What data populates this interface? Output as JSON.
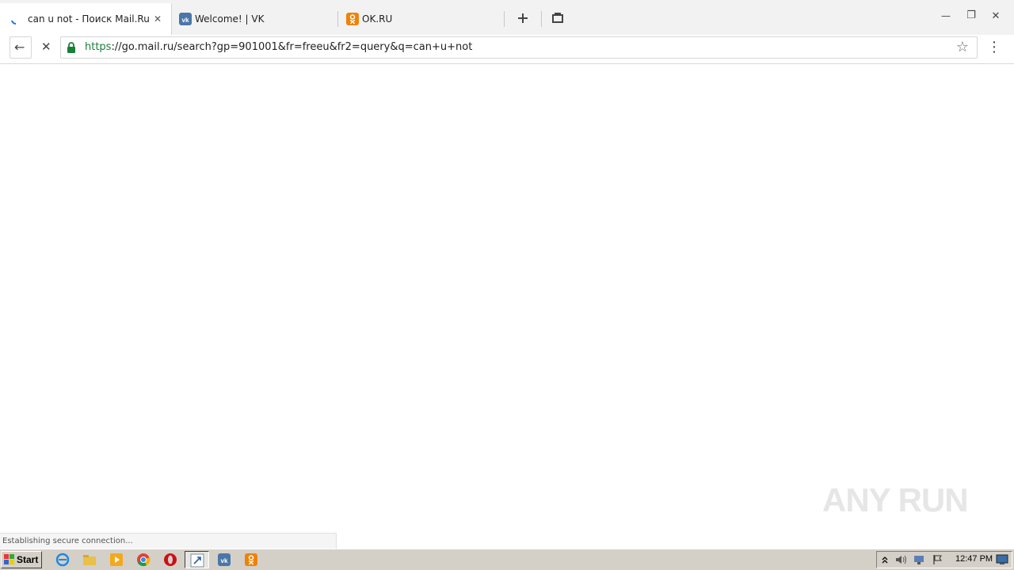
{
  "tabs": [
    {
      "title": "can u not - Поиск Mail.Ru",
      "close": "✕",
      "favicon": "loading-spinner-icon"
    },
    {
      "title": "Welcome! | VK",
      "favicon": "vk-icon"
    },
    {
      "title": "OK.RU",
      "favicon": "ok-icon"
    }
  ],
  "window": {
    "minimize": "—",
    "restore": "❐",
    "close": "✕"
  },
  "toolbar": {
    "back": "←",
    "stop": "✕",
    "url_scheme": "https",
    "url_rest": "://go.mail.ru/search?gp=901001&fr=freeu&fr2=query&q=can+u+not",
    "star": "☆",
    "menu": "⋮"
  },
  "status": {
    "text": "Establishing secure connection..."
  },
  "watermark": {
    "text": "ANY RUN"
  },
  "taskbar": {
    "start_label": "Start",
    "clock": "12:47 PM",
    "tray_icons": [
      "chevron-up-icon",
      "speaker-icon",
      "network-icon",
      "flag-icon",
      "desktop-icon"
    ]
  },
  "colors": {
    "vk": "#4a76a8",
    "ok": "#ee8208",
    "secure": "#1a7f37"
  }
}
